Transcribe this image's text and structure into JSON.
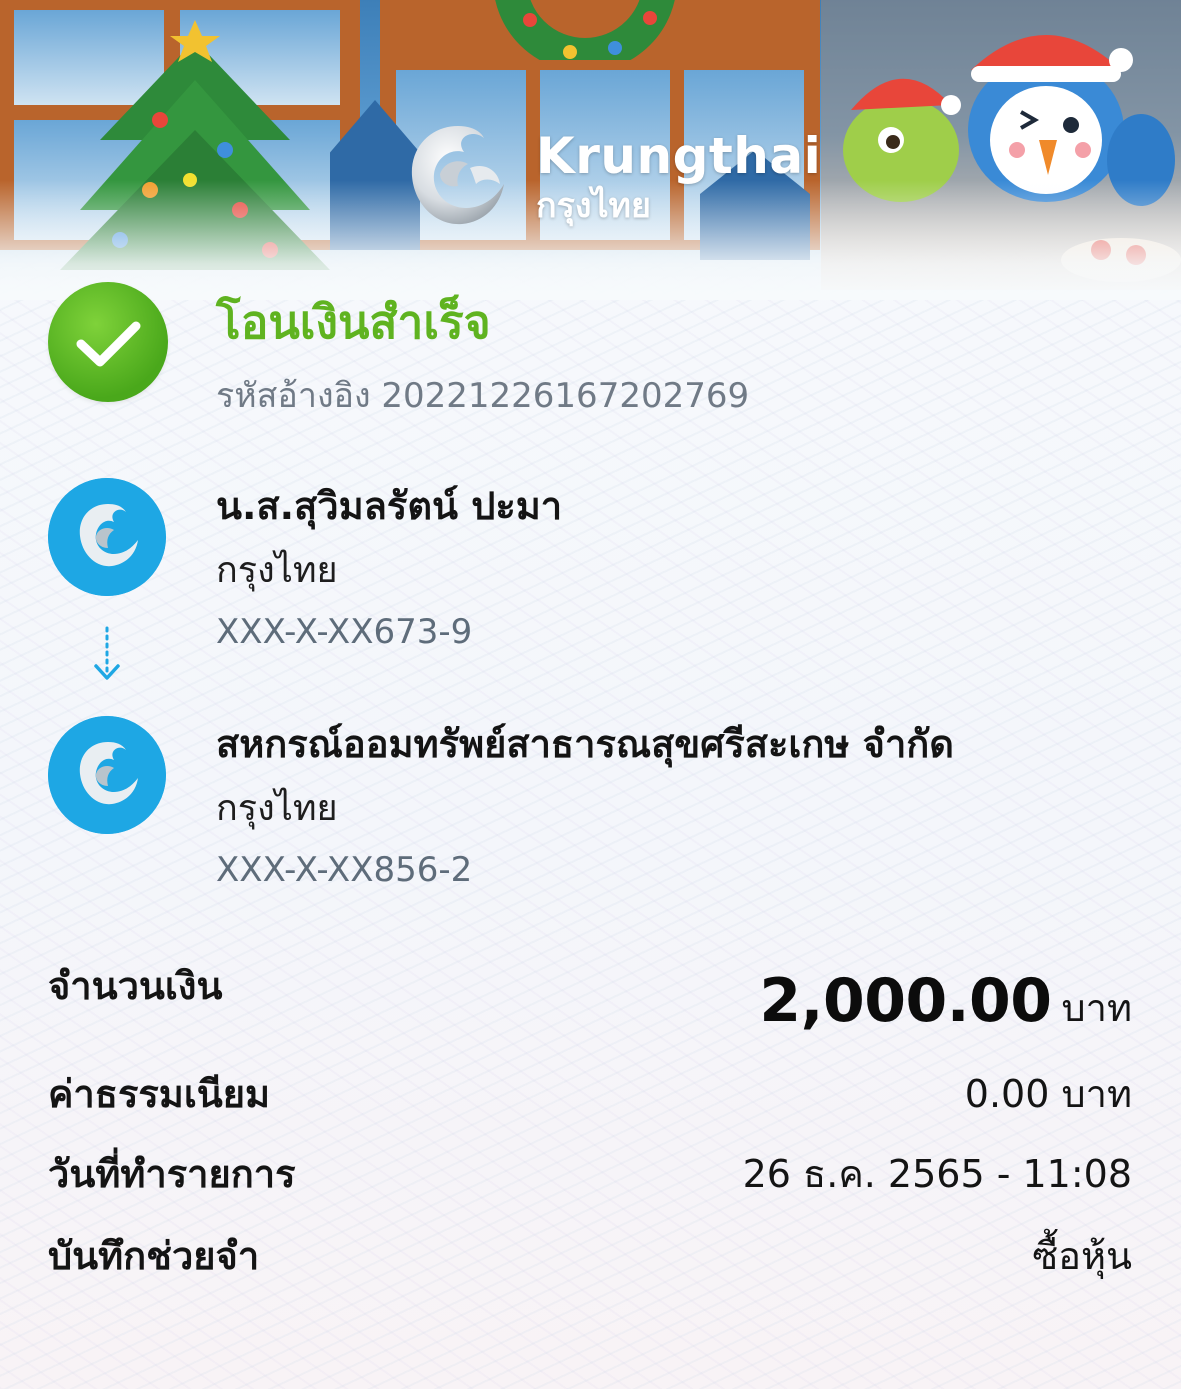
{
  "brand": {
    "name": "Krungthai",
    "name_thai": "กรุงไทย"
  },
  "status": {
    "title": "โอนเงินสำเร็จ",
    "reference_label": "รหัสอ้างอิง",
    "reference_number": "20221226167202769"
  },
  "sender": {
    "name": "น.ส.สุวิมลรัตน์ ปะมา",
    "bank": "กรุงไทย",
    "account": "XXX-X-XX673-9"
  },
  "receiver": {
    "name": "สหกรณ์ออมทรัพย์สาธารณสุขศรีสะเกษ จำกัด",
    "bank": "กรุงไทย",
    "account": "XXX-X-XX856-2"
  },
  "details": {
    "amount_label": "จำนวนเงิน",
    "amount_value": "2,000.00",
    "amount_unit": "บาท",
    "fee_label": "ค่าธรรมเนียม",
    "fee_value": "0.00 บาท",
    "date_label": "วันที่ทำรายการ",
    "date_value": "26 ธ.ค. 2565 - 11:08",
    "memo_label": "บันทึกช่วยจำ",
    "memo_value": "ซื้อหุ้น"
  },
  "colors": {
    "success_green": "#5fb320",
    "bank_blue": "#1ea7e4",
    "muted_text": "#707a86"
  },
  "icons": {
    "status": "check-circle-icon",
    "bank_avatar": "krungthai-bird-logo-icon",
    "flow": "arrow-down-dotted-icon"
  }
}
